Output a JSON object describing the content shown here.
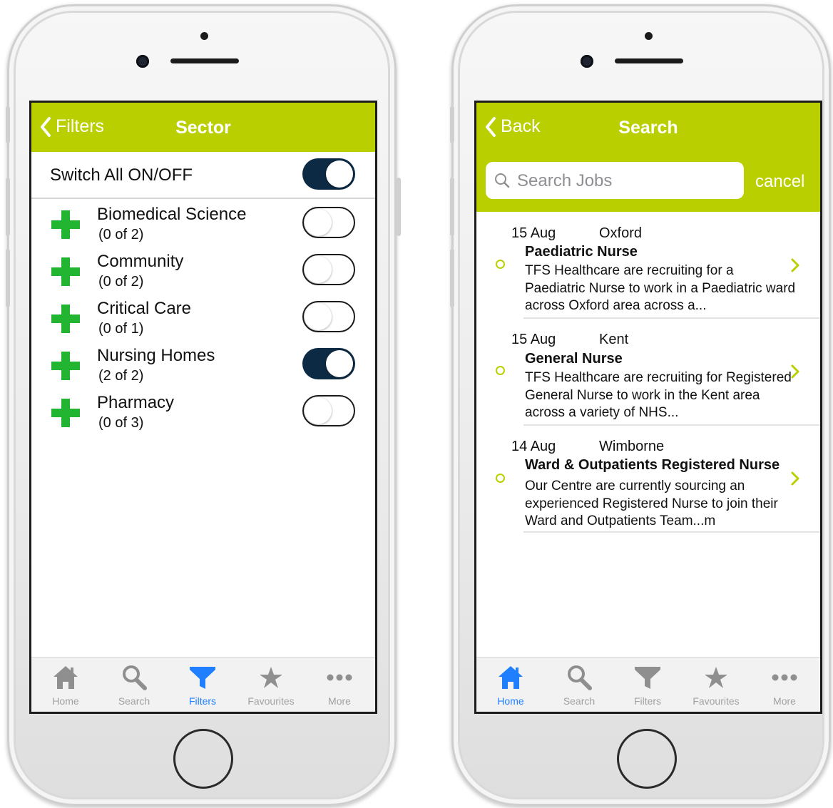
{
  "left_screen": {
    "nav": {
      "back_label": "Filters",
      "title": "Sector"
    },
    "switch_all": {
      "label": "Switch All ON/OFF",
      "on": true
    },
    "sectors": [
      {
        "name": "Biomedical Science",
        "count": "(0 of 2)",
        "on": false
      },
      {
        "name": "Community",
        "count": "(0 of 2)",
        "on": false
      },
      {
        "name": "Critical Care",
        "count": "(0 of 1)",
        "on": false
      },
      {
        "name": "Nursing Homes",
        "count": "(2 of 2)",
        "on": true
      },
      {
        "name": "Pharmacy",
        "count": "(0 of 3)",
        "on": false
      }
    ],
    "tabs": [
      {
        "label": "Home",
        "icon": "home-icon",
        "active": false
      },
      {
        "label": "Search",
        "icon": "search-icon",
        "active": false
      },
      {
        "label": "Filters",
        "icon": "filter-icon",
        "active": true
      },
      {
        "label": "Favourites",
        "icon": "star-icon",
        "active": false
      },
      {
        "label": "More",
        "icon": "more-icon",
        "active": false
      }
    ]
  },
  "right_screen": {
    "nav": {
      "back_label": "Back",
      "title": "Search"
    },
    "search": {
      "placeholder": "Search Jobs",
      "value": "",
      "cancel_label": "cancel"
    },
    "jobs": [
      {
        "date": "15 Aug",
        "location": "Oxford",
        "title": "Paediatric Nurse",
        "description": "TFS Healthcare are recruiting for a Paediatric Nurse to work in a Paediatric ward across Oxford area across a..."
      },
      {
        "date": "15 Aug",
        "location": "Kent",
        "title": "General Nurse",
        "description": "TFS Healthcare are recruiting for Registered General Nurse to work in the Kent area across a variety of NHS..."
      },
      {
        "date": "14 Aug",
        "location": "Wimborne",
        "title": "Ward & Outpatients Registered Nurse",
        "description": "Our Centre are currently sourcing an experienced Registered Nurse to join their Ward and Outpatients Team...m"
      }
    ],
    "tabs": [
      {
        "label": "Home",
        "icon": "home-icon",
        "active": true
      },
      {
        "label": "Search",
        "icon": "search-icon",
        "active": false
      },
      {
        "label": "Filters",
        "icon": "filter-icon",
        "active": false
      },
      {
        "label": "Favourites",
        "icon": "star-icon",
        "active": false
      },
      {
        "label": "More",
        "icon": "more-icon",
        "active": false
      }
    ]
  },
  "colors": {
    "accent": "#b9cf00",
    "toggle_on": "#0d2a45",
    "plus": "#21b531",
    "tab_active": "#1f7fff"
  }
}
